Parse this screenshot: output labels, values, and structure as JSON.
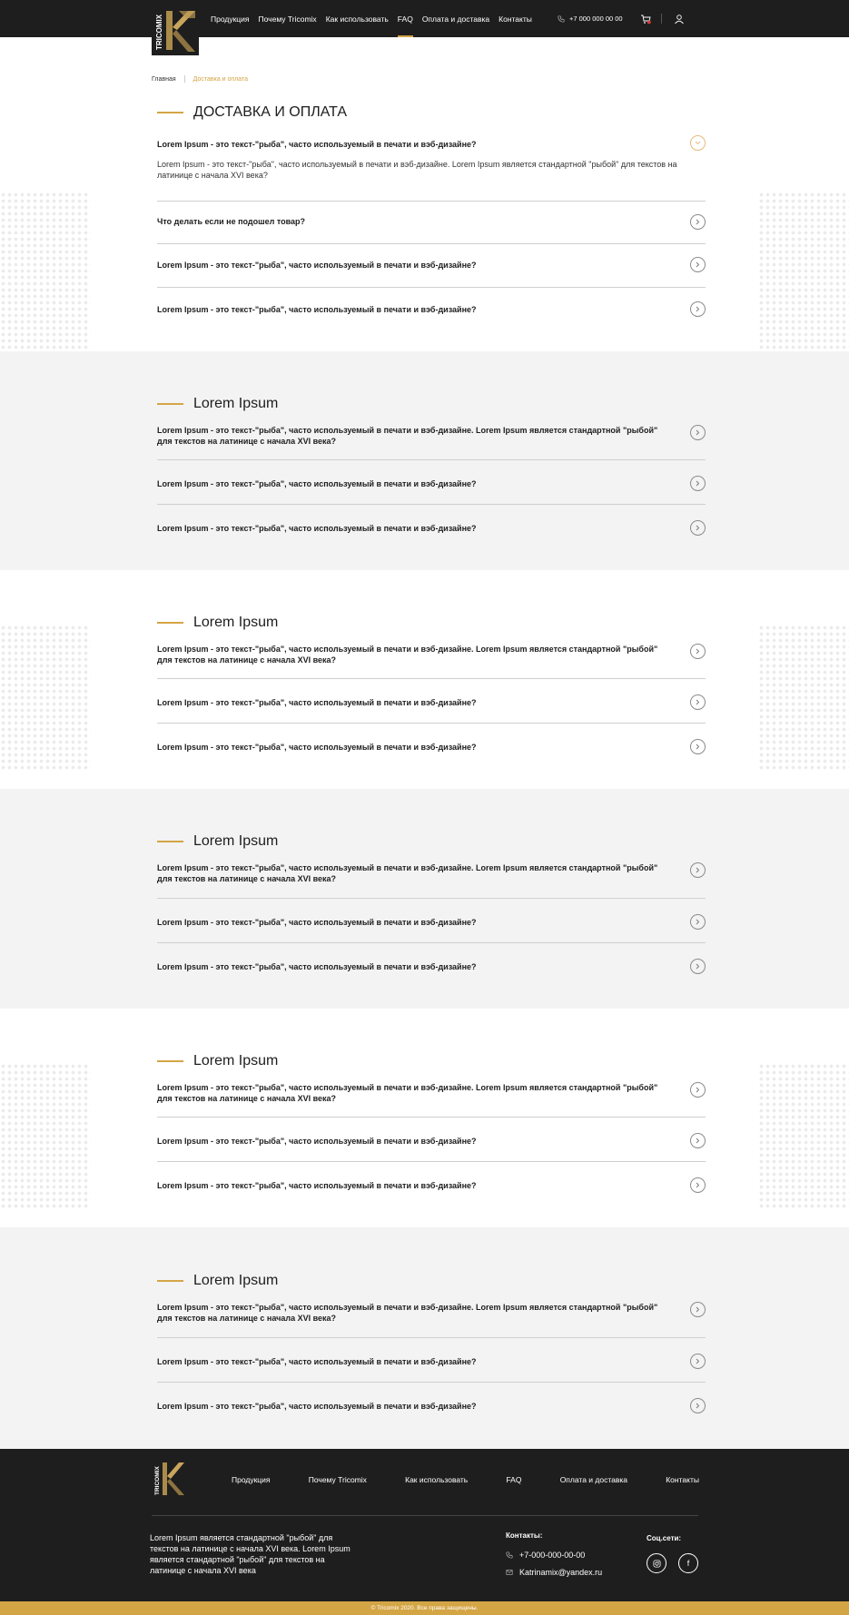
{
  "header": {
    "logo_text": "TRICOMIX",
    "nav": [
      "Продукция",
      "Почему Tricomix",
      "Как использовать",
      "FAQ",
      "Оплата и доставка",
      "Контакты"
    ],
    "active_nav": "FAQ",
    "phone": "+7 000 000 00 00",
    "icons": [
      "phone-icon",
      "cart-icon",
      "user-icon"
    ]
  },
  "breadcrumb": {
    "home": "Главная",
    "current": "Доставка и оплата"
  },
  "sections": [
    {
      "title": "ДОСТАВКА И ОПЛАТА",
      "items": [
        {
          "question": "Lorem Ipsum - это текст-\"рыба\", часто используемый в печати и вэб-дизайне?",
          "answer": "Lorem Ipsum - это текст-\"рыба\", часто используемый в печати и вэб-дизайне. Lorem Ipsum является стандартной \"рыбой\" для текстов на латинице с начала XVI века?",
          "open": true
        },
        {
          "question": "Что делать если не подошел товар?"
        },
        {
          "question": "Lorem Ipsum - это текст-\"рыба\", часто используемый в печати и вэб-дизайне?"
        },
        {
          "question": "Lorem Ipsum - это текст-\"рыба\", часто используемый в печати и вэб-дизайне?"
        }
      ]
    },
    {
      "title": "Lorem Ipsum",
      "items": [
        {
          "question": "Lorem Ipsum - это текст-\"рыба\", часто используемый в печати и вэб-дизайне. Lorem Ipsum является стандартной \"рыбой\" для текстов на латинице с начала XVI века?"
        },
        {
          "question": "Lorem Ipsum - это текст-\"рыба\", часто используемый в печати и вэб-дизайне?"
        },
        {
          "question": "Lorem Ipsum - это текст-\"рыба\", часто используемый в печати и вэб-дизайне?"
        }
      ]
    },
    {
      "title": "Lorem Ipsum",
      "items": [
        {
          "question": "Lorem Ipsum - это текст-\"рыба\", часто используемый в печати и вэб-дизайне. Lorem Ipsum является стандартной \"рыбой\" для текстов на латинице с начала XVI века?"
        },
        {
          "question": "Lorem Ipsum - это текст-\"рыба\", часто используемый в печати и вэб-дизайне?"
        },
        {
          "question": "Lorem Ipsum - это текст-\"рыба\", часто используемый в печати и вэб-дизайне?"
        }
      ]
    },
    {
      "title": "Lorem Ipsum",
      "items": [
        {
          "question": "Lorem Ipsum - это текст-\"рыба\", часто используемый в печати и вэб-дизайне. Lorem Ipsum является стандартной \"рыбой\" для текстов на латинице с начала XVI века?"
        },
        {
          "question": "Lorem Ipsum - это текст-\"рыба\", часто используемый в печати и вэб-дизайне?"
        },
        {
          "question": "Lorem Ipsum - это текст-\"рыба\", часто используемый в печати и вэб-дизайне?"
        }
      ]
    },
    {
      "title": "Lorem Ipsum",
      "items": [
        {
          "question": "Lorem Ipsum - это текст-\"рыба\", часто используемый в печати и вэб-дизайне. Lorem Ipsum является стандартной \"рыбой\" для текстов на латинице с начала XVI века?"
        },
        {
          "question": "Lorem Ipsum - это текст-\"рыба\", часто используемый в печати и вэб-дизайне?"
        },
        {
          "question": "Lorem Ipsum - это текст-\"рыба\", часто используемый в печати и вэб-дизайне?"
        }
      ]
    },
    {
      "title": "Lorem Ipsum",
      "items": [
        {
          "question": "Lorem Ipsum - это текст-\"рыба\", часто используемый в печати и вэб-дизайне. Lorem Ipsum является стандартной \"рыбой\" для текстов на латинице с начала XVI века?"
        },
        {
          "question": "Lorem Ipsum - это текст-\"рыба\", часто используемый в печати и вэб-дизайне?"
        },
        {
          "question": "Lorem Ipsum - это текст-\"рыба\", часто используемый в печати и вэб-дизайне?"
        }
      ]
    }
  ],
  "footer": {
    "logo_text": "TRICOMIX",
    "nav": [
      "Продукция",
      "Почему Tricomix",
      "Как использовать",
      "FAQ",
      "Оплата и доставка",
      "Контакты"
    ],
    "text": "Lorem Ipsum является стандартной \"рыбой\" для текстов на латинице с начала XVI века. Lorem Ipsum является стандартной \"рыбой\" для текстов на латинице с начала XVI века",
    "contacts_title": "Контакты:",
    "phone": "+7-000-000-00-00",
    "email": "Katrinamix@yandex.ru",
    "social_title": "Соц.сети:",
    "social": [
      {
        "icon": "instagram-icon"
      },
      {
        "icon": "facebook-icon",
        "glyph": "f"
      }
    ],
    "copyright": "© Tricomix 2020. Все права защищены."
  },
  "colors": {
    "accent": "#d4a545",
    "dark": "#1e1e1e",
    "gray_bg": "#f3f3f3"
  }
}
